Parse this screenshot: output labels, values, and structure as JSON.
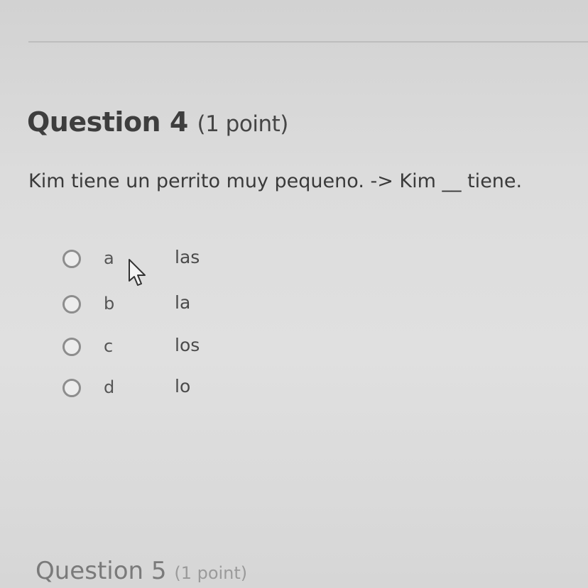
{
  "question4": {
    "heading": "Question 4",
    "points": "(1 point)",
    "prompt": "Kim tiene un perrito muy pequeno. -> Kim __ tiene.",
    "options": [
      {
        "letter": "a",
        "answer": "las"
      },
      {
        "letter": "b",
        "answer": "la"
      },
      {
        "letter": "c",
        "answer": "los"
      },
      {
        "letter": "d",
        "answer": "lo"
      }
    ]
  },
  "question5": {
    "heading": "Question 5",
    "points": "(1 point)"
  },
  "icons": {
    "cursor": "hand-pointer-cursor-icon",
    "radio": "radio-unselected-icon"
  }
}
